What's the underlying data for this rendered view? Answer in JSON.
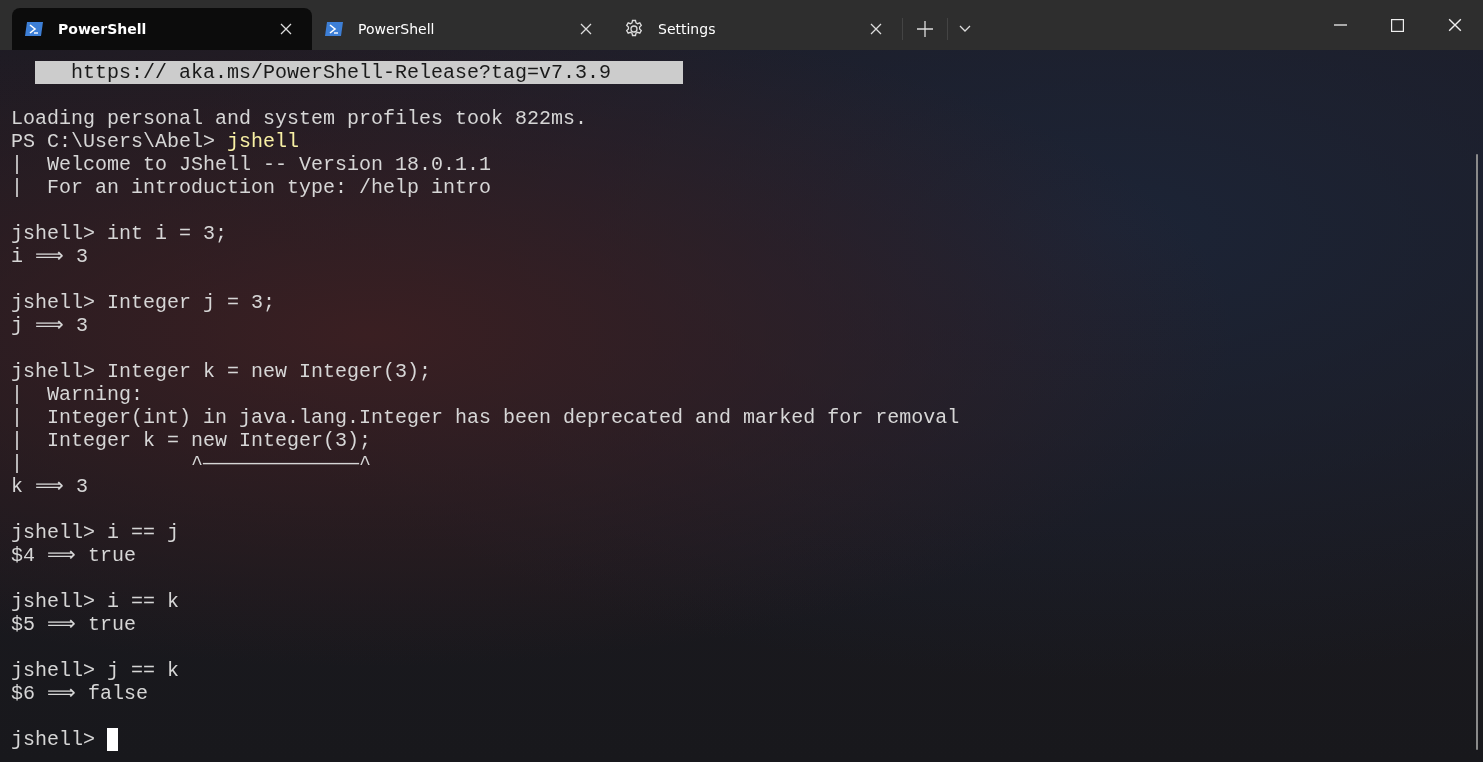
{
  "tabs": [
    {
      "title": "PowerShell",
      "kind": "shell",
      "selected": true
    },
    {
      "title": "PowerShell",
      "kind": "shell",
      "selected": false
    },
    {
      "title": "Settings",
      "kind": "settings",
      "selected": false
    }
  ],
  "terminal": {
    "blocks": [
      [
        {
          "kind": "highlight",
          "text": "https:// aka.ms/PowerShell-Release?tag=v7.3.9"
        }
      ],
      [
        {
          "kind": "output",
          "text": "Loading personal and system profiles took 822ms."
        },
        {
          "kind": "command",
          "prompt": "PS C:\\Users\\Abel> ",
          "text": "jshell"
        },
        {
          "kind": "output",
          "text": "|  Welcome to JShell -- Version 18.0.1.1"
        },
        {
          "kind": "output",
          "text": "|  For an introduction type: /help intro"
        }
      ],
      [
        {
          "kind": "output",
          "text": "jshell> int i = 3;"
        },
        {
          "kind": "output",
          "text": "i ⟹ 3"
        }
      ],
      [
        {
          "kind": "output",
          "text": "jshell> Integer j = 3;"
        },
        {
          "kind": "output",
          "text": "j ⟹ 3"
        }
      ],
      [
        {
          "kind": "output",
          "text": "jshell> Integer k = new Integer(3);"
        },
        {
          "kind": "output",
          "text": "|  Warning:"
        },
        {
          "kind": "output",
          "text": "|  Integer(int) in java.lang.Integer has been deprecated and marked for removal"
        },
        {
          "kind": "output",
          "text": "|  Integer k = new Integer(3);"
        },
        {
          "kind": "output",
          "text": "|              ^—————————————^"
        },
        {
          "kind": "output",
          "text": "k ⟹ 3"
        }
      ],
      [
        {
          "kind": "output",
          "text": "jshell> i == j"
        },
        {
          "kind": "output",
          "text": "$4 ⟹ true"
        }
      ],
      [
        {
          "kind": "output",
          "text": "jshell> i == k"
        },
        {
          "kind": "output",
          "text": "$5 ⟹ true"
        }
      ],
      [
        {
          "kind": "output",
          "text": "jshell> j == k"
        },
        {
          "kind": "output",
          "text": "$6 ⟹ false"
        }
      ],
      [
        {
          "kind": "cursor",
          "text": "jshell> "
        }
      ]
    ]
  }
}
